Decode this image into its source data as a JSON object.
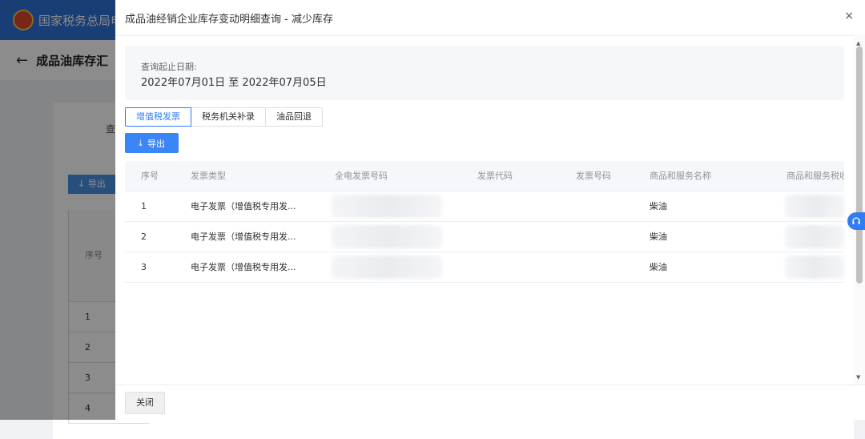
{
  "background": {
    "site_title": "国家税务总局电",
    "back_arrow": "←",
    "page_title": "成品油库存汇",
    "query_label": "查",
    "export_label": "↓ 导出",
    "table_header": "序号",
    "rows": [
      "1",
      "2",
      "3",
      "4"
    ]
  },
  "dialog": {
    "title": "成品油经销企业库存变动明细查询 - 减少库存",
    "close_icon": "×",
    "query": {
      "label": "查询起止日期:",
      "range": "2022年07月01日 至 2022年07月05日"
    },
    "tabs": [
      {
        "label": "增值税发票",
        "active": true
      },
      {
        "label": "税务机关补录",
        "active": false
      },
      {
        "label": "油品回退",
        "active": false
      }
    ],
    "export_button": "导出",
    "table": {
      "columns": [
        "序号",
        "发票类型",
        "全电发票号码",
        "发票代码",
        "发票号码",
        "商品和服务名称",
        "商品和服务税收"
      ],
      "rows": [
        {
          "seq": "1",
          "type": "电子发票（增值税专用发...",
          "invoice_number": "",
          "invoice_code": "",
          "invoice_no": "",
          "goods": "柴油",
          "tax_code": ""
        },
        {
          "seq": "2",
          "type": "电子发票（增值税专用发...",
          "invoice_number": "",
          "invoice_code": "",
          "invoice_no": "",
          "goods": "柴油",
          "tax_code": ""
        },
        {
          "seq": "3",
          "type": "电子发票（增值税专用发...",
          "invoice_number": "",
          "invoice_code": "",
          "invoice_no": "",
          "goods": "柴油",
          "tax_code": ""
        }
      ]
    },
    "footer": {
      "close_button": "关闭"
    }
  },
  "colors": {
    "primary": "#3b86f7",
    "header_blue": "#2f6fd6",
    "overlay": "rgba(0,0,0,0.45)"
  },
  "icons": [
    "emblem-icon",
    "back-arrow-icon",
    "close-icon",
    "download-icon",
    "headset-icon"
  ]
}
